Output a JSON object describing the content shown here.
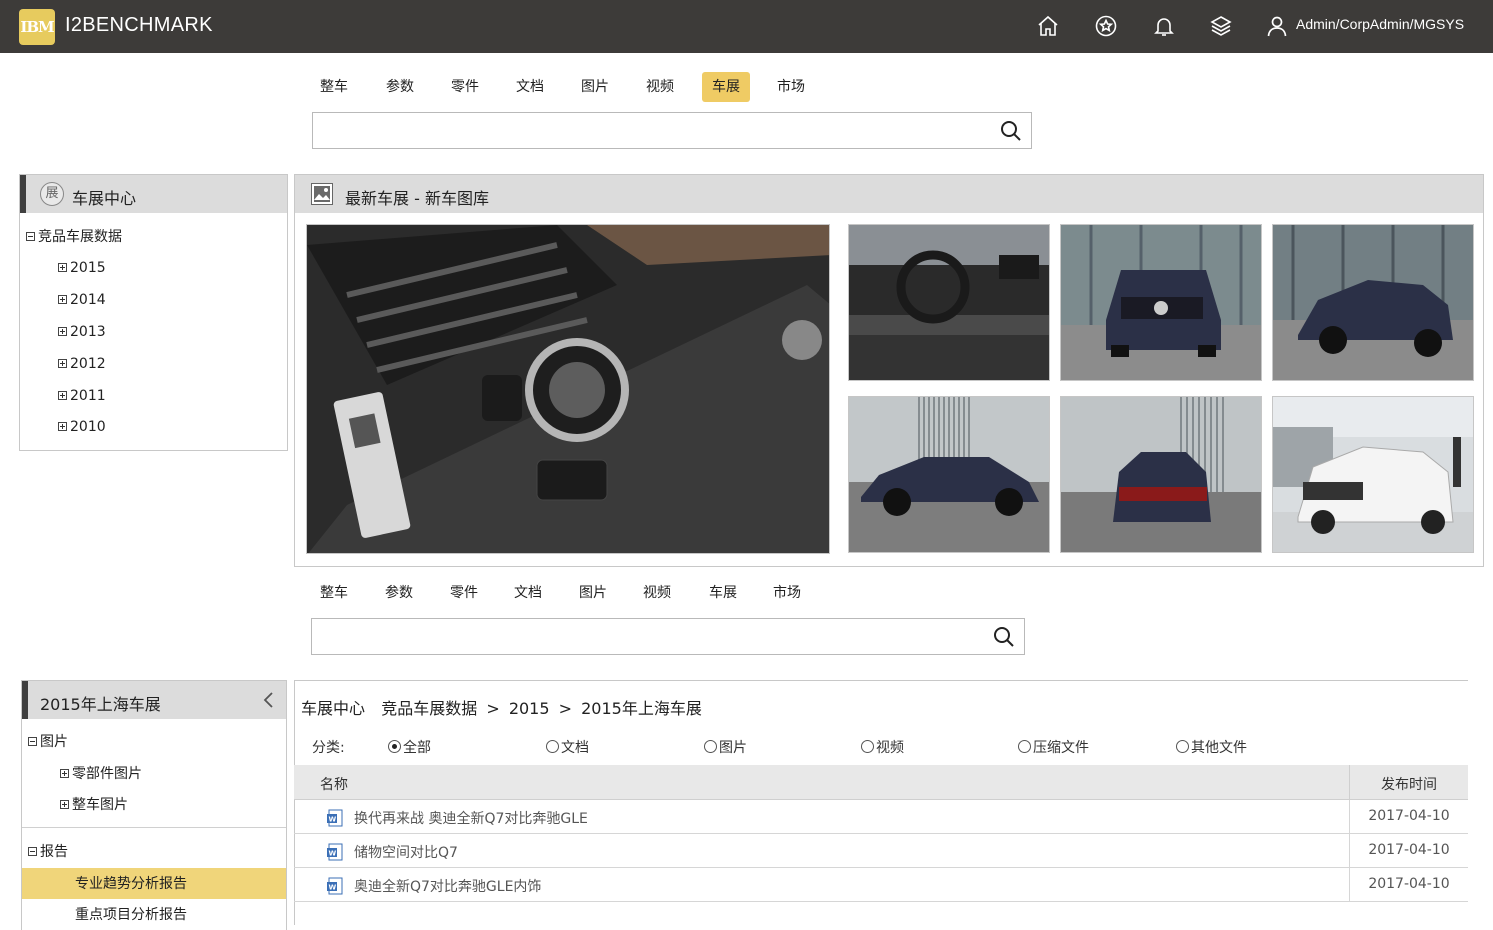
{
  "header": {
    "logo_text": "IBM",
    "app_title": "I2BENCHMARK",
    "user": "Admin/CorpAdmin/MGSYS",
    "icons": [
      "home-icon",
      "star-badge-icon",
      "bell-icon",
      "layers-icon",
      "user-icon"
    ]
  },
  "search_top": {
    "tabs": [
      "整车",
      "参数",
      "零件",
      "文档",
      "图片",
      "视频",
      "车展",
      "市场"
    ],
    "active_tab": "车展",
    "value": ""
  },
  "sidebar_top": {
    "icon_char": "展",
    "title": "车展中心",
    "root": "竞品车展数据",
    "years": [
      "2015",
      "2014",
      "2013",
      "2012",
      "2011",
      "2010"
    ]
  },
  "gallery": {
    "title": "最新车展 - 新车图库",
    "photos": [
      "interior-light-switch",
      "interior-dashboard",
      "suv-front",
      "suv-three-quarter",
      "suv-side",
      "suv-rear",
      "white-suv-show"
    ]
  },
  "search_bottom": {
    "tabs": [
      "整车",
      "参数",
      "零件",
      "文档",
      "图片",
      "视频",
      "车展",
      "市场"
    ],
    "value": ""
  },
  "sidebar_bottom": {
    "title": "2015年上海车展",
    "groups": [
      {
        "label": "图片",
        "children": [
          "零部件图片",
          "整车图片"
        ]
      },
      {
        "label": "报告",
        "children": [
          "专业趋势分析报告",
          "重点项目分析报告"
        ]
      }
    ],
    "selected": "专业趋势分析报告"
  },
  "breadcrumb": {
    "items": [
      "车展中心",
      "竞品车展数据",
      "2015",
      "2015年上海车展"
    ],
    "sep": ">"
  },
  "filter": {
    "label": "分类:",
    "options": [
      "全部",
      "文档",
      "图片",
      "视频",
      "压缩文件",
      "其他文件"
    ],
    "selected": "全部"
  },
  "table": {
    "col_name": "名称",
    "col_date": "发布时间",
    "rows": [
      {
        "name": "换代再来战 奥迪全新Q7对比奔驰GLE",
        "date": "2017-04-10"
      },
      {
        "name": "储物空间对比Q7",
        "date": "2017-04-10"
      },
      {
        "name": "奥迪全新Q7对比奔驰GLE内饰",
        "date": "2017-04-10"
      }
    ]
  },
  "colors": {
    "header_bg": "#3d3b39",
    "accent": "#efcb64",
    "panel_head": "#dcdcdc"
  }
}
